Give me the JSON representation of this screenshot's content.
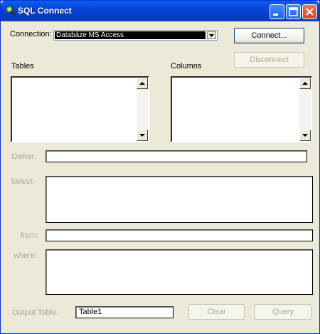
{
  "window": {
    "title": "SQL Connect"
  },
  "connection": {
    "label": "Connection:",
    "selected": "Databáze MS Access"
  },
  "buttons": {
    "connect": "Connect...",
    "disconnect": "Disconnect",
    "clear": "Clear",
    "query": "Query"
  },
  "tables": {
    "label": "Tables"
  },
  "columns": {
    "label": "Columns"
  },
  "owner": {
    "label": "Owner:",
    "value": ""
  },
  "select": {
    "label": "Select:",
    "value": ""
  },
  "from": {
    "label": "from:",
    "value": ""
  },
  "where": {
    "label": "where:",
    "value": ""
  },
  "output": {
    "label": "Output Table:",
    "value": "Table1"
  },
  "colors": {
    "titlebar": "#0846D8",
    "face": "#ECE9D8",
    "disabled_text": "#ACA899"
  },
  "icons": {
    "title": "sql-connect-icon",
    "minimize": "minimize-icon",
    "maximize": "maximize-icon",
    "close": "close-icon"
  }
}
